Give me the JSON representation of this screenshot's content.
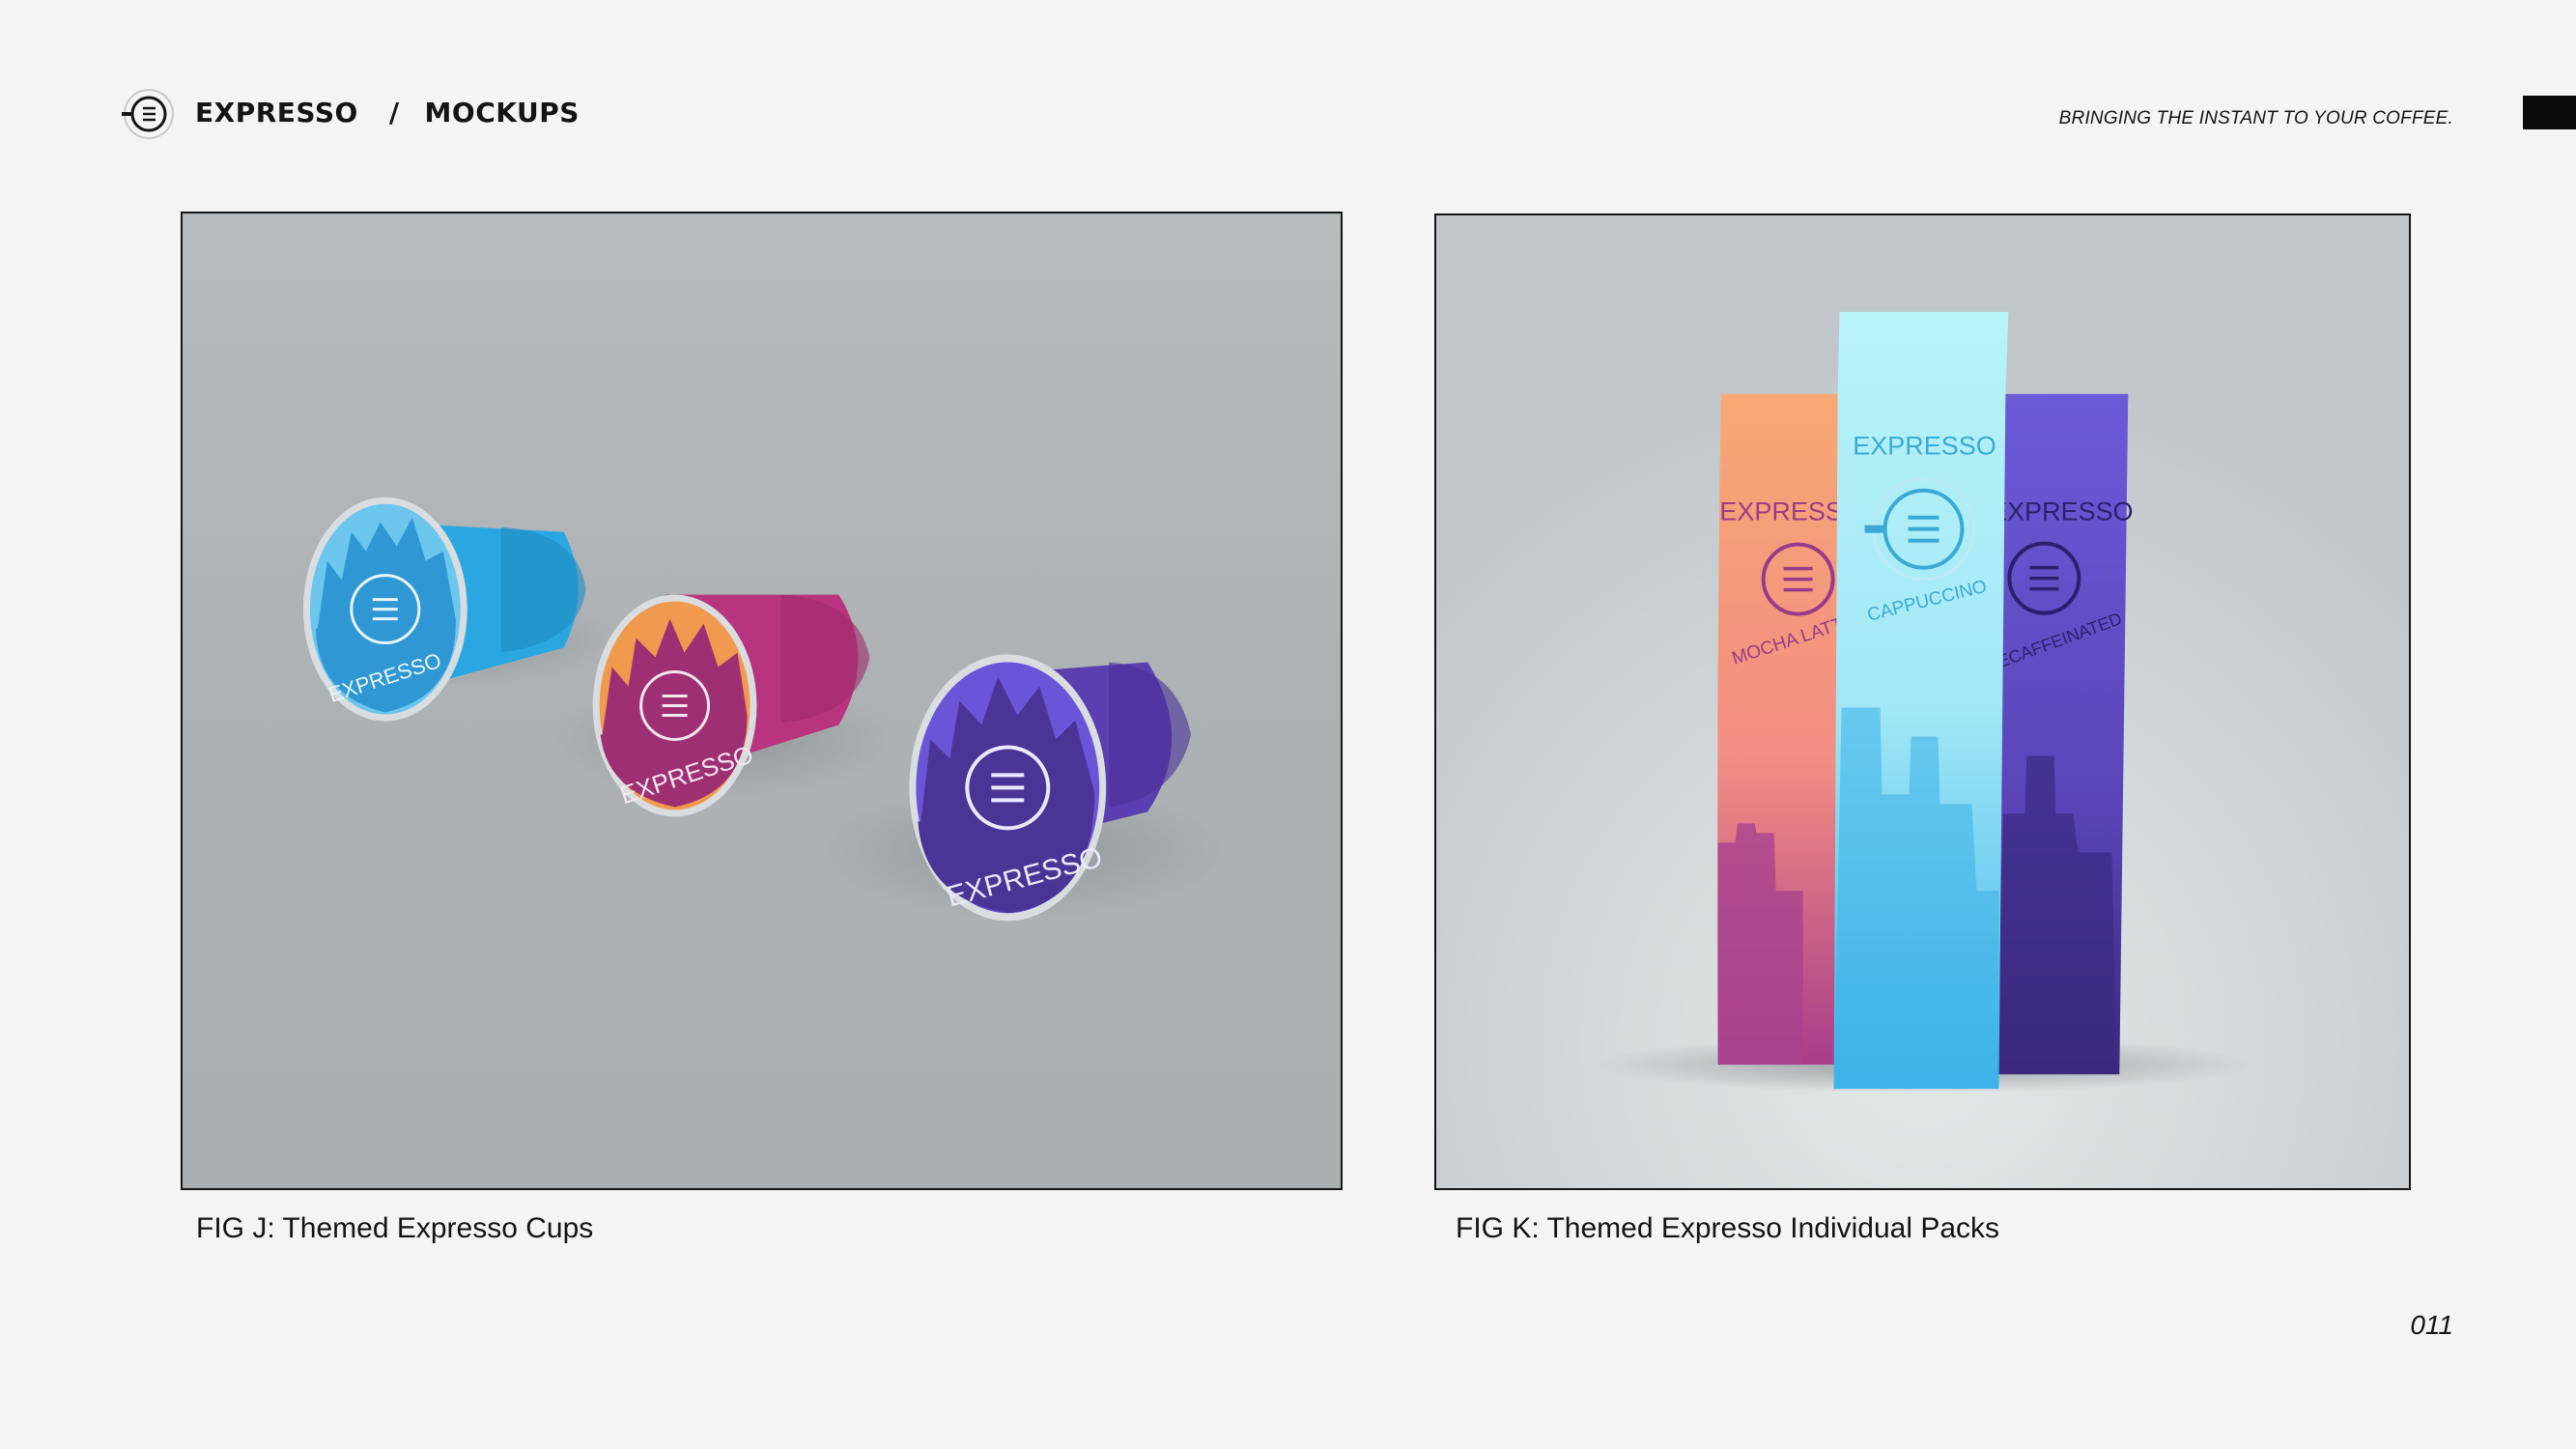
{
  "header": {
    "brand": "EXPRESSO",
    "separator": "/",
    "section": "MOCKUPS",
    "tagline": "BRINGING THE INSTANT TO YOUR COFFEE."
  },
  "figures": [
    {
      "caption": "FIG J: Themed Expresso Cups",
      "items": [
        {
          "label": "EXPRESSO",
          "color": "#2aa6e0"
        },
        {
          "label": "EXPRESSO",
          "color": "#b8347e"
        },
        {
          "label": "EXPRESSO",
          "color": "#5a3fb0"
        }
      ]
    },
    {
      "caption": "FIG K: Themed Expresso Individual Packs",
      "items": [
        {
          "brand": "EXPRESSO",
          "flavor": "MOCHA LATTE",
          "color": "#f4a57a"
        },
        {
          "brand": "EXPRESSO",
          "flavor": "CAPPUCCINO",
          "color": "#a9f0f6"
        },
        {
          "brand": "EXPRESSO",
          "flavor": "DECAFFEINATED",
          "color": "#6a55d8"
        }
      ]
    }
  ],
  "page_number": "011",
  "colors": {
    "background": "#f4f4f4",
    "photo_background": "#b7bcbe",
    "text": "#141414"
  }
}
